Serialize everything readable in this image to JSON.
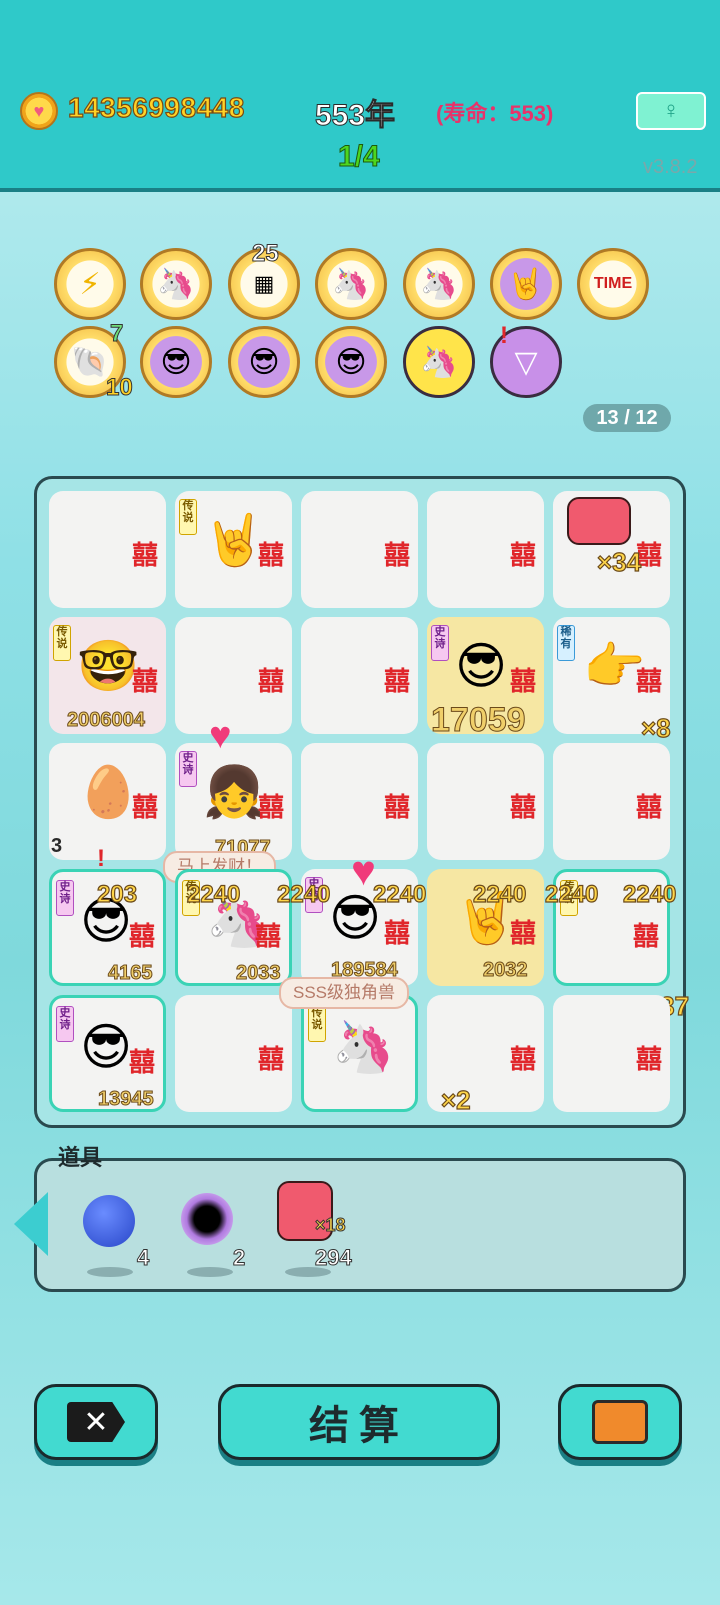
{
  "header": {
    "coin_icon": "heart-coin-icon",
    "coins": "14356998448",
    "year": "553年",
    "lifespan": "(寿命：553)",
    "progress": "1/4",
    "version": "v3.8.2",
    "meditate_icon": "meditate-icon"
  },
  "skills": {
    "row1": [
      "⚡",
      "🦄",
      "25",
      "🦄",
      "🦄",
      "🤘",
      "TIME"
    ],
    "row2_badges": {
      "shell_top": "7",
      "shell_bottom": "10"
    },
    "counter": "13 / 12"
  },
  "board": {
    "tags": {
      "legend": "传说",
      "epic": "史诗",
      "rare": "稀有"
    },
    "cells": {
      "liver1_mult": "×34",
      "king_value": "2006004",
      "green_face_value": "17059",
      "pointer_mult": "×8",
      "egg_value": "3",
      "girl_value": "71077",
      "row4_values": [
        "4165",
        "2033",
        "189584",
        "2032"
      ],
      "row4_floats": [
        "2240",
        "2240",
        "2240",
        "2240",
        "2240",
        "2240"
      ],
      "row4_first_float": "203",
      "liver2_mult": "×37",
      "row5_value": "13945",
      "unicorn_liver_mult": "×2"
    },
    "bubbles": {
      "rich": "马上发财！",
      "unicorn": "SSS级独角兽"
    }
  },
  "items": {
    "label": "道具",
    "list": [
      {
        "name": "blueberry",
        "count": "4"
      },
      {
        "name": "black-hole",
        "count": "2"
      },
      {
        "name": "liver",
        "mult": "×18",
        "count": "294"
      }
    ]
  },
  "buttons": {
    "close_label": "✕",
    "settle_label": "结算",
    "bag_icon": "briefcase-icon"
  }
}
